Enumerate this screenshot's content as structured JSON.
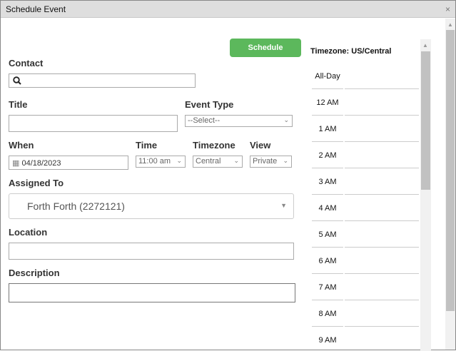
{
  "dialog": {
    "title": "Schedule Event",
    "close": "×"
  },
  "form": {
    "schedule_label": "Schedule",
    "contact_label": "Contact",
    "contact_value": "",
    "title_label": "Title",
    "title_value": "",
    "event_type_label": "Event Type",
    "event_type_value": "--Select--",
    "when_label": "When",
    "when_value": "04/18/2023",
    "time_label": "Time",
    "time_value": "11:00 am",
    "timezone_label": "Timezone",
    "timezone_value": "Central",
    "view_label": "View",
    "view_value": "Private",
    "assigned_label": "Assigned To",
    "assigned_value": "Forth Forth (2272121)",
    "location_label": "Location",
    "location_value": "",
    "description_label": "Description",
    "description_value": ""
  },
  "calendar": {
    "timezone": "Timezone: US/Central",
    "allday": "All-Day",
    "hours": [
      "12 AM",
      "1 AM",
      "2 AM",
      "3 AM",
      "4 AM",
      "5 AM",
      "6 AM",
      "7 AM",
      "8 AM",
      "9 AM"
    ]
  }
}
